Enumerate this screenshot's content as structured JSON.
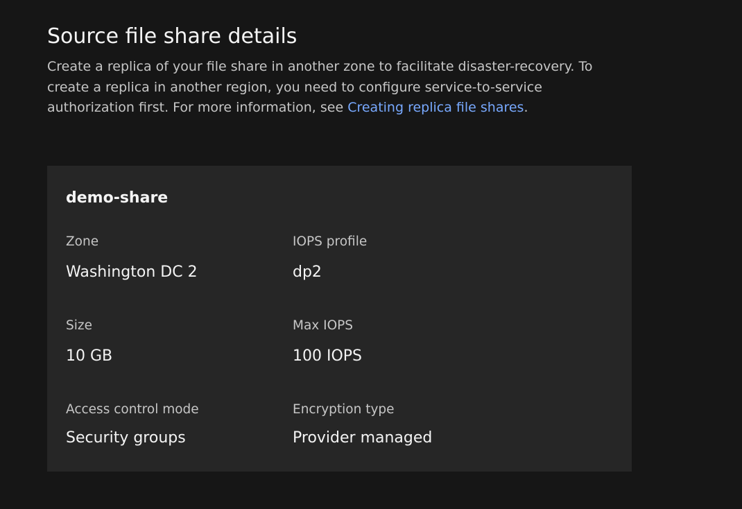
{
  "section": {
    "title": "Source file share details",
    "description": "Create a replica of your file share in another zone to facilitate disaster-recovery. To create a replica in another region, you need to configure service-to-service authorization first. For more information, see",
    "link_text": "Creating replica file shares",
    "link_suffix": "."
  },
  "share": {
    "name": "demo-share",
    "details": [
      {
        "label": "Zone",
        "value": "Washington DC 2"
      },
      {
        "label": "IOPS profile",
        "value": "dp2"
      },
      {
        "label": "Size",
        "value": "10 GB"
      },
      {
        "label": "Max IOPS",
        "value": "100 IOPS"
      },
      {
        "label": "Access control mode",
        "value": "Security groups"
      },
      {
        "label": "Encryption type",
        "value": "Provider managed"
      }
    ]
  },
  "colors": {
    "background": "#161616",
    "tile": "#262626",
    "link": "#78a9ff"
  }
}
